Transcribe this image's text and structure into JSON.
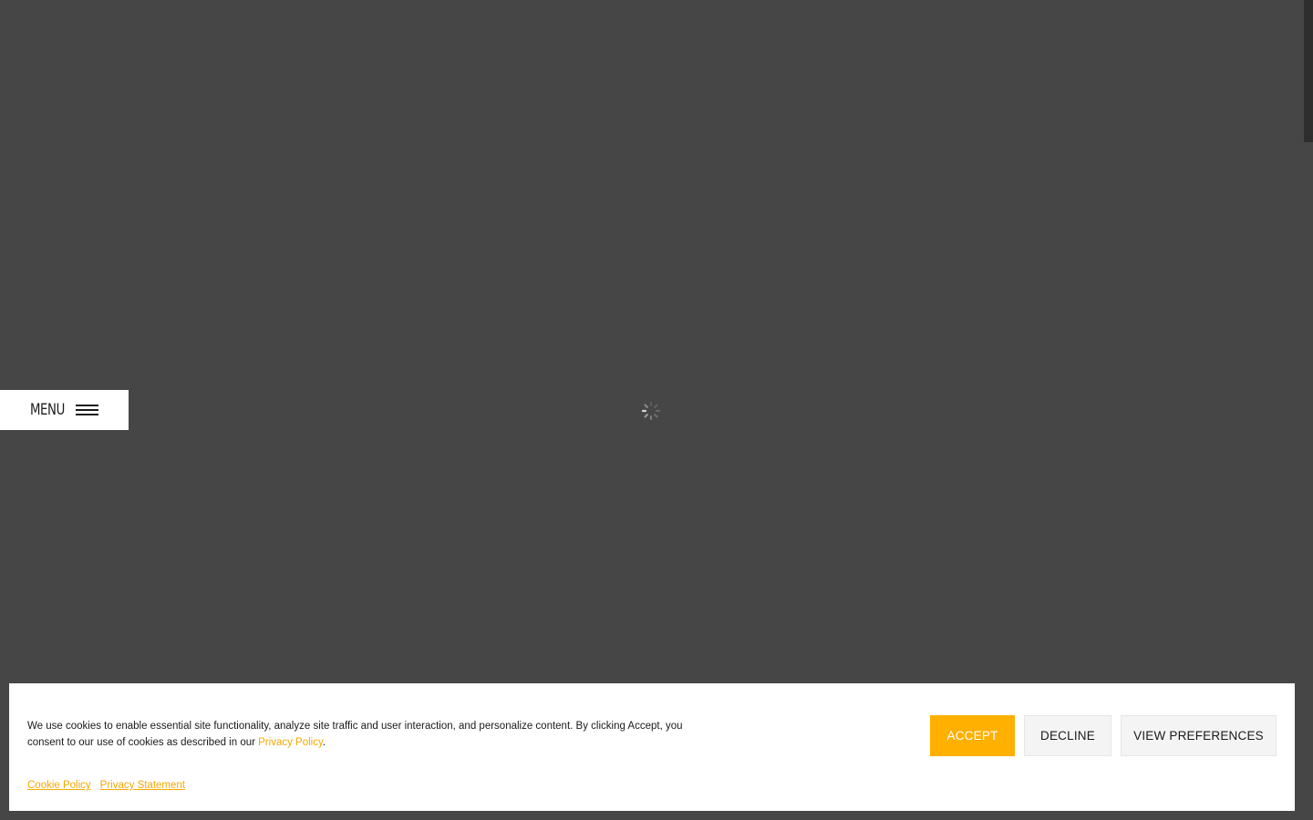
{
  "menu": {
    "label": "MENU",
    "icon": "hamburger-icon"
  },
  "loader": {
    "icon": "spinner-icon"
  },
  "cookie_banner": {
    "message_before_link": "We use cookies to enable essential site functionality, analyze site traffic and user interaction, and personalize content. By clicking Accept, you consent to our use of cookies as described in our ",
    "privacy_policy_link": "Privacy Policy",
    "message_after_link": ".",
    "cookie_policy_link": "Cookie Policy",
    "privacy_statement_link": "Privacy Statement",
    "accept_label": "ACCEPT",
    "decline_label": "DECLINE",
    "preferences_label": "VIEW PREFERENCES"
  },
  "colors": {
    "background": "#464646",
    "accent": "#ffb000",
    "link": "#f5a800",
    "banner": "#ffffff"
  }
}
